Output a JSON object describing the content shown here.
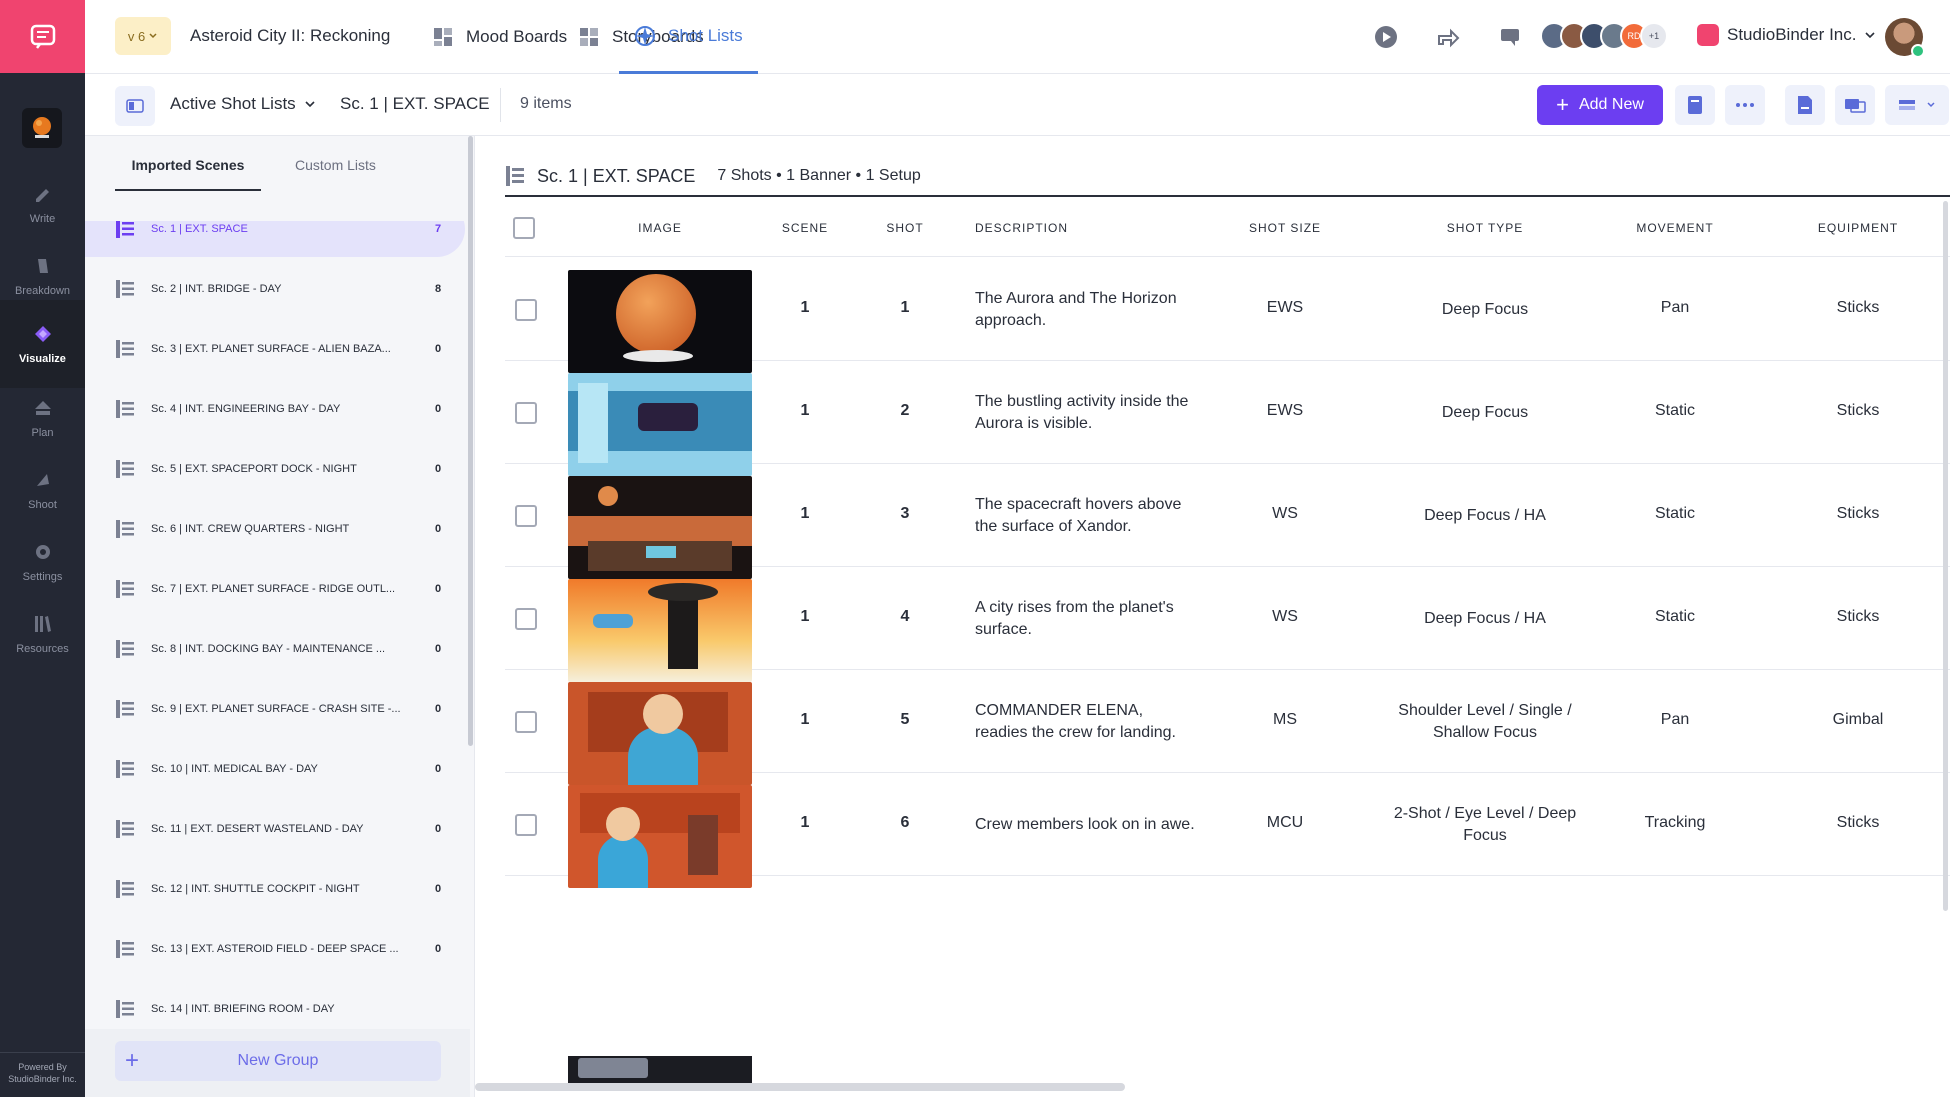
{
  "app": {
    "version": "v 6",
    "project_title": "Asteroid City II: Reckoning",
    "tabs": [
      {
        "label": "Mood Boards",
        "icon": "mood-board-icon"
      },
      {
        "label": "Storyboards",
        "icon": "storyboard-icon"
      },
      {
        "label": "Shot Lists",
        "icon": "shot-list-icon"
      }
    ],
    "active_tab": "Shot Lists",
    "org_name": "StudioBinder Inc.",
    "avatars_extra": "+1",
    "avatar_initials": "RD",
    "accent_color": "#6c3ef1",
    "brand_color": "#f0446f"
  },
  "rail": {
    "items": [
      {
        "label": "Write",
        "icon": "pencil-icon"
      },
      {
        "label": "Breakdown",
        "icon": "breakdown-icon"
      },
      {
        "label": "Visualize",
        "icon": "visualize-icon"
      },
      {
        "label": "Plan",
        "icon": "plan-icon"
      },
      {
        "label": "Shoot",
        "icon": "shoot-icon"
      },
      {
        "label": "Settings",
        "icon": "gear-icon"
      },
      {
        "label": "Resources",
        "icon": "resources-icon"
      }
    ],
    "active": "Visualize",
    "powered_line1": "Powered By",
    "powered_line2": "StudioBinder Inc."
  },
  "subbar": {
    "list_selector": "Active Shot Lists",
    "breadcrumb": "Sc. 1 | EXT. SPACE",
    "item_count": "9 items",
    "add_new": "Add New"
  },
  "sidepanel": {
    "tab_imported": "Imported Scenes",
    "tab_custom": "Custom Lists",
    "scenes": [
      {
        "label": "Sc. 1 | EXT. SPACE",
        "count": "7"
      },
      {
        "label": "Sc. 2 | INT. BRIDGE - DAY",
        "count": "8"
      },
      {
        "label": "Sc. 3 | EXT. PLANET SURFACE - ALIEN BAZA...",
        "count": "0"
      },
      {
        "label": "Sc. 4 | INT. ENGINEERING BAY - DAY",
        "count": "0"
      },
      {
        "label": "Sc. 5 | EXT. SPACEPORT DOCK - NIGHT",
        "count": "0"
      },
      {
        "label": "Sc. 6 | INT. CREW QUARTERS - NIGHT",
        "count": "0"
      },
      {
        "label": "Sc. 7 | EXT. PLANET SURFACE - RIDGE OUTL...",
        "count": "0"
      },
      {
        "label": "Sc. 8 | INT. DOCKING BAY - MAINTENANCE ...",
        "count": "0"
      },
      {
        "label": "Sc. 9 | EXT. PLANET SURFACE - CRASH SITE -...",
        "count": "0"
      },
      {
        "label": "Sc. 10 | INT. MEDICAL BAY - DAY",
        "count": "0"
      },
      {
        "label": "Sc. 11 | EXT. DESERT WASTELAND - DAY",
        "count": "0"
      },
      {
        "label": "Sc. 12 | INT. SHUTTLE COCKPIT - NIGHT",
        "count": "0"
      },
      {
        "label": "Sc. 13 | EXT. ASTEROID FIELD - DEEP SPACE ...",
        "count": "0"
      },
      {
        "label": "Sc. 14 | INT. BRIEFING ROOM - DAY",
        "count": ""
      }
    ],
    "new_group": "New Group"
  },
  "main": {
    "group_title": "Sc. 1 | EXT. SPACE",
    "group_meta": "7 Shots • 1 Banner • 1 Setup",
    "columns": [
      "IMAGE",
      "SCENE",
      "SHOT",
      "DESCRIPTION",
      "SHOT SIZE",
      "SHOT TYPE",
      "MOVEMENT",
      "EQUIPMENT"
    ],
    "rows": [
      {
        "scene": "1",
        "shot": "1",
        "description": "The Aurora and The Horizon approach.",
        "size": "EWS",
        "type": "Deep Focus",
        "movement": "Pan",
        "equipment": "Sticks"
      },
      {
        "scene": "1",
        "shot": "2",
        "description": "The bustling activity inside the Aurora is visible.",
        "size": "EWS",
        "type": "Deep Focus",
        "movement": "Static",
        "equipment": "Sticks"
      },
      {
        "scene": "1",
        "shot": "3",
        "description": "The spacecraft hovers above the surface of Xandor.",
        "size": "WS",
        "type": "Deep Focus / HA",
        "movement": "Static",
        "equipment": "Sticks"
      },
      {
        "scene": "1",
        "shot": "4",
        "description": "A city rises from the planet's surface.",
        "size": "WS",
        "type": "Deep Focus / HA",
        "movement": "Static",
        "equipment": "Sticks"
      },
      {
        "scene": "1",
        "shot": "5",
        "description": "COMMANDER ELENA, readies the crew for landing.",
        "size": "MS",
        "type": "Shoulder Level / Single / Shallow Focus",
        "movement": "Pan",
        "equipment": "Gimbal"
      },
      {
        "scene": "1",
        "shot": "6",
        "description": "Crew members look on in awe.",
        "size": "MCU",
        "type": "2-Shot / Eye Level / Deep Focus",
        "movement": "Tracking",
        "equipment": "Sticks"
      }
    ]
  }
}
